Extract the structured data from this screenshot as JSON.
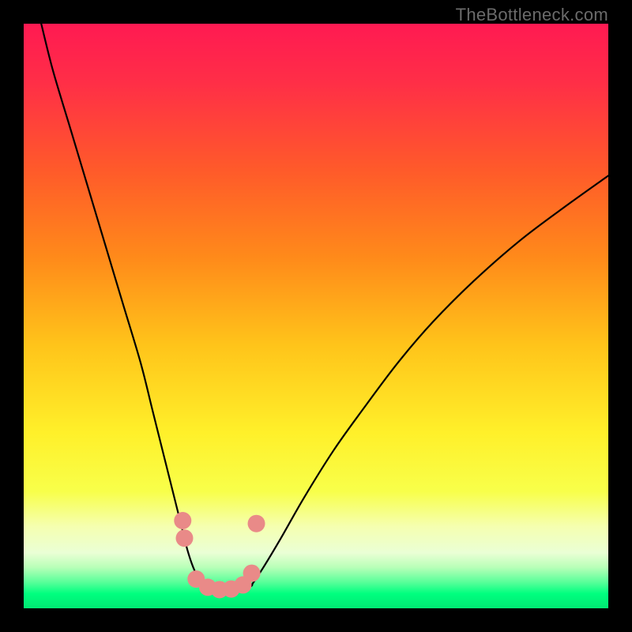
{
  "watermark": "TheBottleneck.com",
  "colors": {
    "frame_bg": "#000000",
    "curve": "#000000",
    "marker_fill": "#e98a88",
    "marker_stroke": "#d46f6d",
    "gradient_stops": [
      {
        "offset": 0.0,
        "color": "#ff1a52"
      },
      {
        "offset": 0.1,
        "color": "#ff2e47"
      },
      {
        "offset": 0.25,
        "color": "#ff5a2a"
      },
      {
        "offset": 0.4,
        "color": "#ff8a1a"
      },
      {
        "offset": 0.55,
        "color": "#ffc41a"
      },
      {
        "offset": 0.7,
        "color": "#fff02a"
      },
      {
        "offset": 0.8,
        "color": "#f8ff4a"
      },
      {
        "offset": 0.86,
        "color": "#f5ffb0"
      },
      {
        "offset": 0.905,
        "color": "#eaffd5"
      },
      {
        "offset": 0.93,
        "color": "#b8ffb8"
      },
      {
        "offset": 0.955,
        "color": "#5aff9a"
      },
      {
        "offset": 0.975,
        "color": "#00ff7f"
      },
      {
        "offset": 1.0,
        "color": "#00e873"
      }
    ]
  },
  "chart_data": {
    "type": "line",
    "title": "",
    "xlabel": "",
    "ylabel": "",
    "xlim": [
      0,
      100
    ],
    "ylim": [
      0,
      100
    ],
    "grid": false,
    "legend": false,
    "series": [
      {
        "name": "left-branch",
        "x": [
          3,
          5,
          8,
          11,
          14,
          17,
          20,
          22,
          24,
          25.5,
          27,
          28,
          29,
          30,
          31
        ],
        "y": [
          100,
          92,
          82,
          72,
          62,
          52,
          42,
          34,
          26,
          20,
          14,
          10,
          7,
          5,
          4
        ]
      },
      {
        "name": "trough",
        "x": [
          31,
          33,
          35,
          37,
          39
        ],
        "y": [
          4,
          3.2,
          3,
          3.2,
          4
        ]
      },
      {
        "name": "right-branch",
        "x": [
          39,
          41,
          44,
          48,
          53,
          58,
          64,
          70,
          77,
          85,
          93,
          100
        ],
        "y": [
          4,
          7,
          12,
          19,
          27,
          34,
          42,
          49,
          56,
          63,
          69,
          74
        ]
      }
    ],
    "markers": {
      "name": "highlighted-points",
      "x": [
        27.2,
        27.5,
        29.5,
        31.5,
        33.5,
        35.5,
        37.5,
        39.0,
        39.8
      ],
      "y": [
        15.0,
        12.0,
        5.0,
        3.6,
        3.2,
        3.3,
        4.0,
        6.0,
        14.5
      ],
      "r": [
        11,
        11,
        11,
        11,
        11,
        11,
        11,
        11,
        11
      ]
    }
  }
}
